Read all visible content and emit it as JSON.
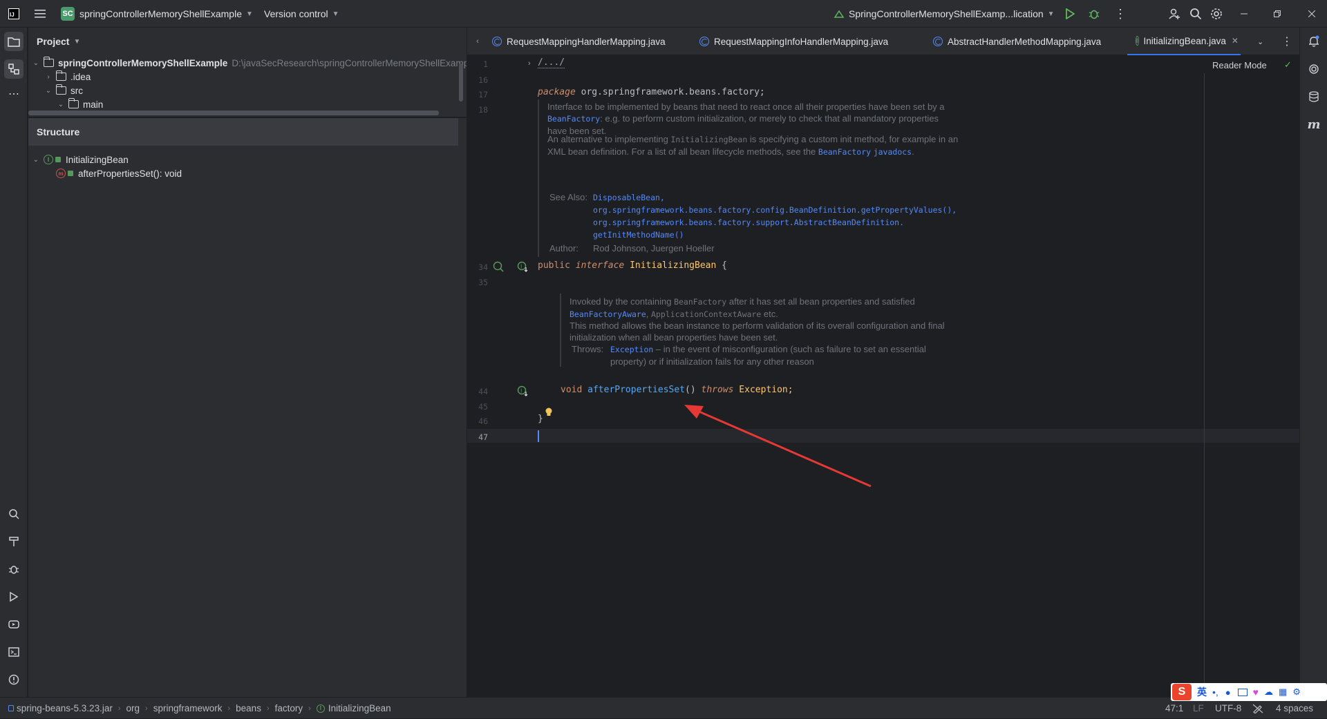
{
  "titlebar": {
    "project_badge": "SC",
    "project_name": "springControllerMemoryShellExample",
    "vcs": "Version control",
    "run_config": "SpringControllerMemoryShellExamp...lication"
  },
  "project_panel": {
    "title": "Project",
    "root_name": "springControllerMemoryShellExample",
    "root_path": "D:\\javaSecResearch\\springControllerMemoryShellExamp",
    "items": [
      ".idea",
      "src",
      "main"
    ]
  },
  "structure_panel": {
    "title": "Structure",
    "class_name": "InitializingBean",
    "method": "afterPropertiesSet(): void"
  },
  "tabs": [
    {
      "label": "RequestMappingHandlerMapping.java"
    },
    {
      "label": "RequestMappingInfoHandlerMapping.java"
    },
    {
      "label": "AbstractHandlerMethodMapping.java"
    },
    {
      "label": "InitializingBean.java"
    }
  ],
  "editor": {
    "reader_mode": "Reader Mode",
    "line_numbers": [
      "1",
      "16",
      "17",
      "18",
      "34",
      "35",
      "44",
      "45",
      "46",
      "47"
    ],
    "fold": "/.../",
    "package_kw": "package",
    "package_name": " org.springframework.beans.factory;",
    "doc1": {
      "p1_a": "Interface to be implemented by beans that need to react once all their properties have been set by a",
      "p1_link": "BeanFactory",
      "p1_b": ": e.g. to perform custom initialization, or merely to check that all mandatory properties",
      "p1_c": "have been set.",
      "p2_a": "An alternative to implementing ",
      "p2_code": "InitializingBean",
      "p2_b": " is specifying a custom init method, for example in an",
      "p2_c": "XML bean definition. For a list of all bean lifecycle methods, see the ",
      "p2_link1": "BeanFactory",
      "p2_link2": "javadocs",
      "p2_end": ".",
      "see_also_label": "See Also:",
      "see_also": [
        "DisposableBean,",
        "org.springframework.beans.factory.config.BeanDefinition.getPropertyValues(),",
        "org.springframework.beans.factory.support.AbstractBeanDefinition.",
        "getInitMethodName()"
      ],
      "author_label": "Author:",
      "author": "Rod Johnson, Juergen Hoeller"
    },
    "decl_public": "public",
    "decl_interface": "interface",
    "decl_name": "InitializingBean",
    "decl_brace": " {",
    "doc2": {
      "p1_a": "Invoked by the containing ",
      "p1_code": "BeanFactory",
      "p1_b": " after it has set all bean properties and satisfied",
      "p1_link": "BeanFactoryAware",
      "p1_c": ", ",
      "p1_code2": "ApplicationContextAware",
      "p1_d": " etc.",
      "p2_a": "This method allows the bean instance to perform validation of its overall configuration and final",
      "p2_b": "initialization when all bean properties have been set.",
      "throws_label": "Throws:",
      "throws_link": "Exception",
      "throws_a": " – in the event of misconfiguration (such as failure to set an essential",
      "throws_b": "property) or if initialization fails for any other reason"
    },
    "method_void": "void",
    "method_name": "afterPropertiesSet",
    "method_parens": "()",
    "method_throws": "throws",
    "method_exc": " Exception;",
    "close_brace": "}"
  },
  "statusbar": {
    "breadcrumbs": [
      "spring-beans-5.3.23.jar",
      "org",
      "springframework",
      "beans",
      "factory",
      "InitializingBean"
    ],
    "position": "47:1",
    "line_sep": "LF",
    "encoding": "UTF-8",
    "indent": "4 spaces"
  },
  "ime": {
    "lang": "英"
  },
  "colors": {
    "accent": "#3574f0",
    "arrow": "#e53935",
    "bg": "#1e1f22",
    "panel": "#2b2d30"
  }
}
